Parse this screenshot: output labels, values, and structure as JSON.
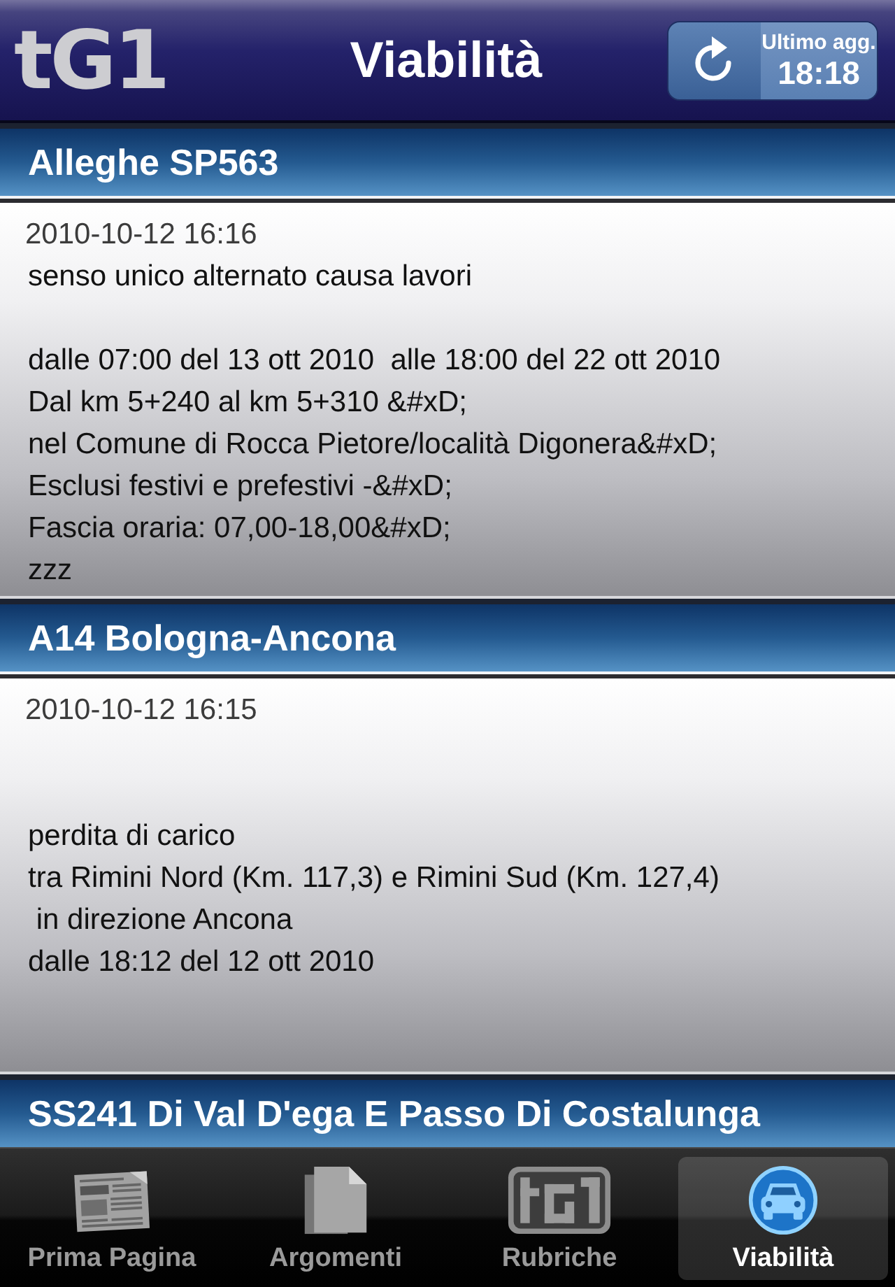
{
  "header": {
    "logo": "tG1",
    "title": "Viabilità",
    "refresh": {
      "label": "Ultimo agg.",
      "time": "18:18"
    }
  },
  "items": [
    {
      "title": "Alleghe SP563",
      "date": "2010-10-12 16:16",
      "body": "senso unico alternato causa lavori\n\ndalle 07:00 del 13 ott 2010  alle 18:00 del 22 ott 2010\nDal km 5+240 al km 5+310 &#xD;\nnel Comune di Rocca Pietore/località Digonera&#xD;\nEsclusi festivi e prefestivi -&#xD;\nFascia oraria: 07,00-18,00&#xD;\nzzz"
    },
    {
      "title": "A14 Bologna-Ancona",
      "date": "2010-10-12 16:15",
      "body": "\n\nperdita di carico\ntra Rimini Nord (Km. 117,3) e Rimini Sud (Km. 127,4)\n in direzione Ancona\ndalle 18:12 del 12 ott 2010"
    },
    {
      "title": "SS241 Di Val D'ega E Passo Di Costalunga"
    }
  ],
  "tab_bar": [
    {
      "label": "Prima Pagina",
      "selected": false
    },
    {
      "label": "Argomenti",
      "selected": false
    },
    {
      "label": "Rubriche",
      "selected": false
    },
    {
      "label": "Viabilità",
      "selected": true
    }
  ]
}
